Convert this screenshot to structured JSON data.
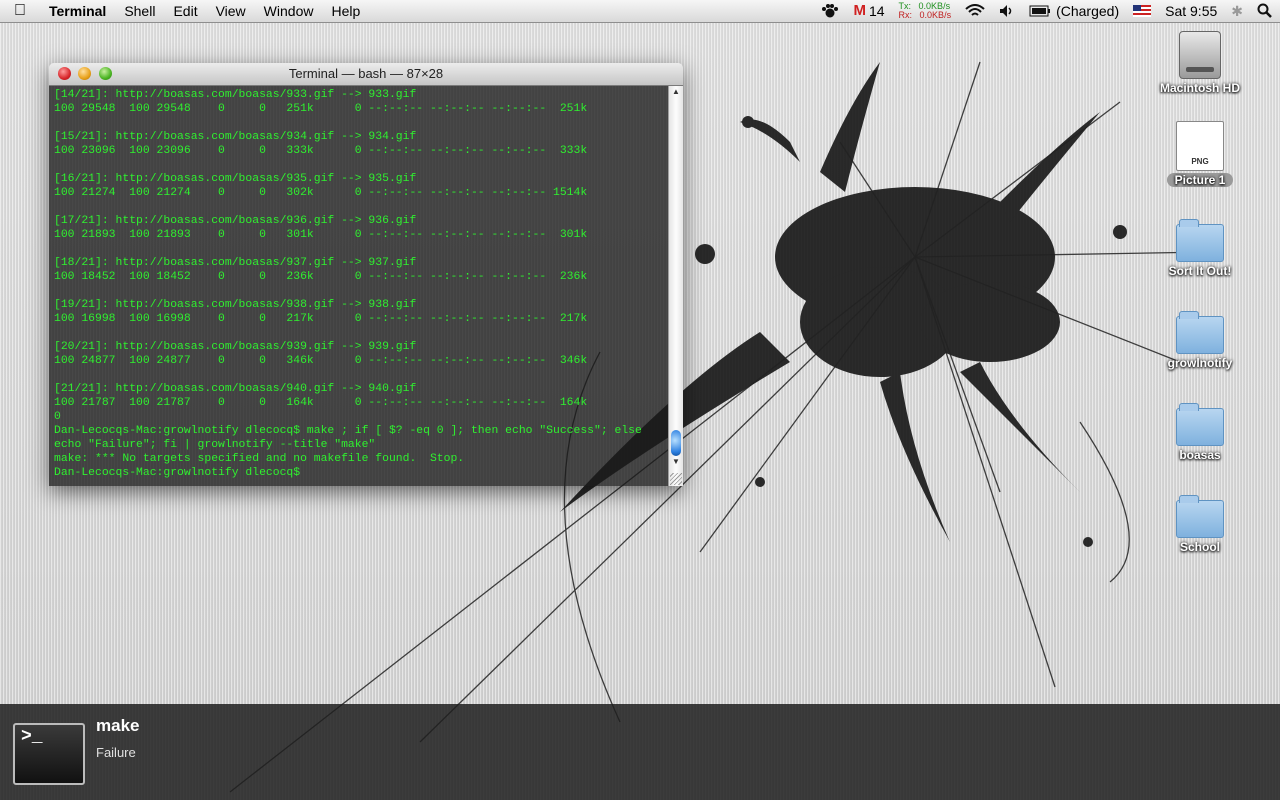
{
  "menubar": {
    "apple": "",
    "items": [
      "Terminal",
      "Shell",
      "Edit",
      "View",
      "Window",
      "Help"
    ],
    "gmail_count": "14",
    "net_tx_label": "Tx:",
    "net_tx_value": "0.0KB/s",
    "net_rx_label": "Rx:",
    "net_rx_value": "0.0KB/s",
    "battery": "(Charged)",
    "clock": "Sat 9:55"
  },
  "terminal": {
    "title": "Terminal — bash — 87×28",
    "lines": [
      "[14/21]: http://boasas.com/boasas/933.gif --> 933.gif",
      "100 29548  100 29548    0     0   251k      0 --:--:-- --:--:-- --:--:--  251k",
      "",
      "[15/21]: http://boasas.com/boasas/934.gif --> 934.gif",
      "100 23096  100 23096    0     0   333k      0 --:--:-- --:--:-- --:--:--  333k",
      "",
      "[16/21]: http://boasas.com/boasas/935.gif --> 935.gif",
      "100 21274  100 21274    0     0   302k      0 --:--:-- --:--:-- --:--:-- 1514k",
      "",
      "[17/21]: http://boasas.com/boasas/936.gif --> 936.gif",
      "100 21893  100 21893    0     0   301k      0 --:--:-- --:--:-- --:--:--  301k",
      "",
      "[18/21]: http://boasas.com/boasas/937.gif --> 937.gif",
      "100 18452  100 18452    0     0   236k      0 --:--:-- --:--:-- --:--:--  236k",
      "",
      "[19/21]: http://boasas.com/boasas/938.gif --> 938.gif",
      "100 16998  100 16998    0     0   217k      0 --:--:-- --:--:-- --:--:--  217k",
      "",
      "[20/21]: http://boasas.com/boasas/939.gif --> 939.gif",
      "100 24877  100 24877    0     0   346k      0 --:--:-- --:--:-- --:--:--  346k",
      "",
      "[21/21]: http://boasas.com/boasas/940.gif --> 940.gif",
      "100 21787  100 21787    0     0   164k      0 --:--:-- --:--:-- --:--:--  164k",
      "0",
      "Dan-Lecocqs-Mac:growlnotify dlecocq$ make ; if [ $? -eq 0 ]; then echo \"Success\"; else",
      "echo \"Failure\"; fi | growlnotify --title \"make\"",
      "make: *** No targets specified and no makefile found.  Stop.",
      "Dan-Lecocqs-Mac:growlnotify dlecocq$ "
    ]
  },
  "desktop_icons": [
    {
      "label": "Macintosh HD",
      "kind": "hd-icon"
    },
    {
      "label": "Picture 1",
      "kind": "png-icon",
      "badge": "PNG"
    },
    {
      "label": "Sort It Out!",
      "kind": "folder-icon"
    },
    {
      "label": "growlnotify",
      "kind": "folder-icon"
    },
    {
      "label": "boasas",
      "kind": "folder-icon"
    },
    {
      "label": "School",
      "kind": "folder-icon"
    }
  ],
  "growl": {
    "title": "make",
    "description": "Failure",
    "icon_glyph": ">_"
  },
  "colors": {
    "terminal_text": "#2ff02f",
    "gmail_red": "#d02020"
  }
}
